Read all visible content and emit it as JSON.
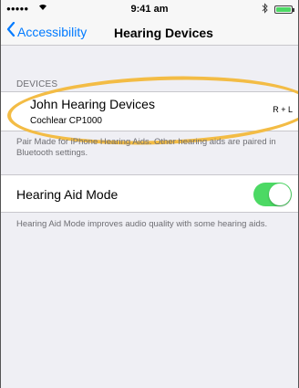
{
  "status_bar": {
    "signal": "●●●●●",
    "time": "9:41 am"
  },
  "nav": {
    "back_label": "Accessibility",
    "title": "Hearing Devices"
  },
  "devices_section": {
    "header": "DEVICES",
    "device": {
      "name": "John Hearing Devices",
      "model": "Cochlear CP1000",
      "side": "R + L"
    },
    "footer": "Pair Made for iPhone Hearing Aids. Other hearing aids are paired in Bluetooth settings."
  },
  "hearing_aid_mode": {
    "label": "Hearing Aid Mode",
    "enabled": true,
    "footer": "Hearing Aid Mode improves audio quality with some hearing aids."
  },
  "colors": {
    "accent": "#007aff",
    "switch_on": "#4cd964",
    "highlight": "#f3bc45"
  }
}
